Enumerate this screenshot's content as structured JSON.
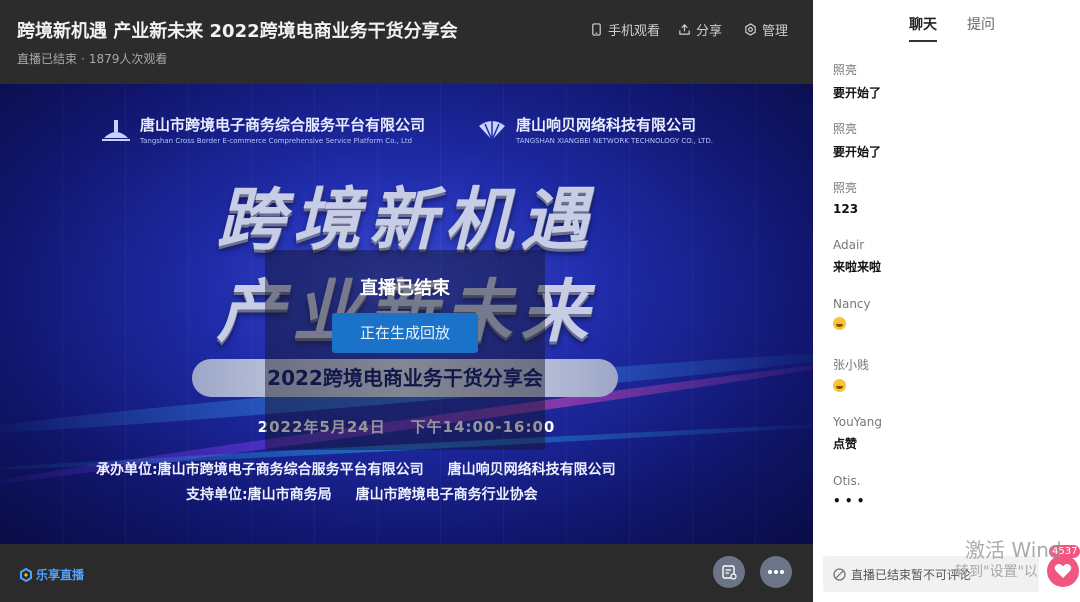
{
  "header": {
    "title": "跨境新机遇 产业新未来 2022跨境电商业务干货分享会",
    "status": "直播已结束",
    "separator": "·",
    "views": "1879人次观看",
    "actions": {
      "mobile": "手机观看",
      "share": "分享",
      "manage": "管理"
    }
  },
  "poster": {
    "org1_name": "唐山市跨境电子商务综合服务平台有限公司",
    "org1_en": "Tangshan Cross Border E-commerce Comprehensive Service Platform Co., Ltd",
    "org2_name": "唐山响贝网络科技有限公司",
    "org2_en": "TANGSHAN XIANGBEI NETWORK TECHNOLOGY CO., LTD.",
    "headline1": "跨境新机遇",
    "headline2": "产业新未来",
    "slogan": "2022跨境电商业务干货分享会",
    "date": "2022年5月24日",
    "time": "下午14:00-16:00",
    "host_label": "承办单位:唐山市跨境电子商务综合服务平台有限公司",
    "host2": "唐山响贝网络科技有限公司",
    "support_label": "支持单位:唐山市商务局",
    "support2": "唐山市跨境电子商务行业协会"
  },
  "overlay": {
    "ended": "直播已结束",
    "replay": "正在生成回放"
  },
  "footer": {
    "brand": "乐享直播"
  },
  "side": {
    "tabs": {
      "chat": "聊天",
      "qa": "提问"
    },
    "messages": [
      {
        "user": "照亮",
        "text": "要开始了"
      },
      {
        "user": "照亮",
        "text": "要开始了"
      },
      {
        "user": "照亮",
        "text": "123"
      },
      {
        "user": "Adair",
        "text": "来啦来啦"
      },
      {
        "user": "Nancy",
        "emoji": "smile-emoji"
      },
      {
        "user": "张小贱",
        "emoji": "smile-emoji"
      },
      {
        "user": "YouYang",
        "text": "点赞"
      },
      {
        "user": "Otis.",
        "text": "• • •"
      }
    ],
    "chat_disabled": "直播已结束暂不可评论",
    "like_count": "4537"
  },
  "watermark": {
    "line1": "激活 Wind",
    "line2": "转到\"设置\"以"
  },
  "colors": {
    "accent": "#1a73c8",
    "brand": "#4fa2ff",
    "like": "#f0567f"
  }
}
